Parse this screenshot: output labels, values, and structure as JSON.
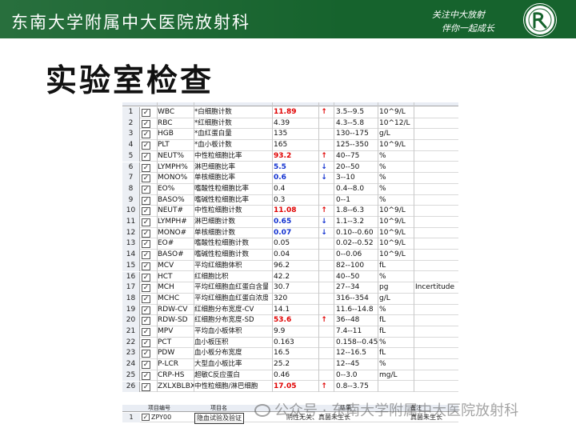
{
  "header": {
    "hospital_name": "东南大学附属中大医院放射科",
    "slogan_line1": "关注中大放射",
    "slogan_line2": "伴你一起成长",
    "bg_color": "#16632d"
  },
  "page_title": "实验室检查",
  "table": {
    "rows": [
      {
        "no": "1",
        "code": "WBC",
        "name": "*白细胞计数",
        "result": "11.89",
        "flag": "↑",
        "level": "high",
        "ref": "3.5--9.5",
        "unit": "10^9/L",
        "note": ""
      },
      {
        "no": "2",
        "code": "RBC",
        "name": "*红细胞计数",
        "result": "4.39",
        "flag": "",
        "level": "normal",
        "ref": "4.3--5.8",
        "unit": "10^12/L",
        "note": ""
      },
      {
        "no": "3",
        "code": "HGB",
        "name": "*血红蛋白量",
        "result": "135",
        "flag": "",
        "level": "normal",
        "ref": "130--175",
        "unit": "g/L",
        "note": ""
      },
      {
        "no": "4",
        "code": "PLT",
        "name": "*血小板计数",
        "result": "165",
        "flag": "",
        "level": "normal",
        "ref": "125--350",
        "unit": "10^9/L",
        "note": ""
      },
      {
        "no": "5",
        "code": "NEUT%",
        "name": "中性粒细胞比率",
        "result": "93.2",
        "flag": "↑",
        "level": "high",
        "ref": "40--75",
        "unit": "%",
        "note": ""
      },
      {
        "no": "6",
        "code": "LYMPH%",
        "name": "淋巴细胞比率",
        "result": "5.5",
        "flag": "↓",
        "level": "low",
        "ref": "20--50",
        "unit": "%",
        "note": ""
      },
      {
        "no": "7",
        "code": "MONO%",
        "name": "单核细胞比率",
        "result": "0.6",
        "flag": "↓",
        "level": "low",
        "ref": "3--10",
        "unit": "%",
        "note": ""
      },
      {
        "no": "8",
        "code": "EO%",
        "name": "嗜酸性粒细胞比率",
        "result": "0.4",
        "flag": "",
        "level": "normal",
        "ref": "0.4--8.0",
        "unit": "%",
        "note": ""
      },
      {
        "no": "9",
        "code": "BASO%",
        "name": "嗜碱性粒细胞比率",
        "result": "0.3",
        "flag": "",
        "level": "normal",
        "ref": "0--1",
        "unit": "%",
        "note": ""
      },
      {
        "no": "10",
        "code": "NEUT#",
        "name": "中性粒细胞计数",
        "result": "11.08",
        "flag": "↑",
        "level": "high",
        "ref": "1.8--6.3",
        "unit": "10^9/L",
        "note": ""
      },
      {
        "no": "11",
        "code": "LYMPH#",
        "name": "淋巴细胞计数",
        "result": "0.65",
        "flag": "↓",
        "level": "low",
        "ref": "1.1--3.2",
        "unit": "10^9/L",
        "note": ""
      },
      {
        "no": "12",
        "code": "MONO#",
        "name": "单核细胞计数",
        "result": "0.07",
        "flag": "↓",
        "level": "low",
        "ref": "0.10--0.60",
        "unit": "10^9/L",
        "note": ""
      },
      {
        "no": "13",
        "code": "EO#",
        "name": "嗜酸性粒细胞计数",
        "result": "0.05",
        "flag": "",
        "level": "normal",
        "ref": "0.02--0.52",
        "unit": "10^9/L",
        "note": ""
      },
      {
        "no": "14",
        "code": "BASO#",
        "name": "嗜碱性粒细胞计数",
        "result": "0.04",
        "flag": "",
        "level": "normal",
        "ref": "0--0.06",
        "unit": "10^9/L",
        "note": ""
      },
      {
        "no": "15",
        "code": "MCV",
        "name": "平均红细胞体积",
        "result": "96.2",
        "flag": "",
        "level": "normal",
        "ref": "82--100",
        "unit": "fL",
        "note": ""
      },
      {
        "no": "16",
        "code": "HCT",
        "name": "红细胞比积",
        "result": "42.2",
        "flag": "",
        "level": "normal",
        "ref": "40--50",
        "unit": "%",
        "note": ""
      },
      {
        "no": "17",
        "code": "MCH",
        "name": "平均红细胞血红蛋白含量",
        "result": "30.7",
        "flag": "",
        "level": "normal",
        "ref": "27--34",
        "unit": "pg",
        "note": "Incertitude"
      },
      {
        "no": "18",
        "code": "MCHC",
        "name": "平均红细胞血红蛋白浓度",
        "result": "320",
        "flag": "",
        "level": "normal",
        "ref": "316--354",
        "unit": "g/L",
        "note": ""
      },
      {
        "no": "19",
        "code": "RDW-CV",
        "name": "红细胞分布宽度-CV",
        "result": "14.1",
        "flag": "",
        "level": "normal",
        "ref": "11.6--14.8",
        "unit": "%",
        "note": ""
      },
      {
        "no": "20",
        "code": "RDW-SD",
        "name": "红细胞分布宽度-SD",
        "result": "53.6",
        "flag": "↑",
        "level": "high",
        "ref": "36--48",
        "unit": "fL",
        "note": ""
      },
      {
        "no": "21",
        "code": "MPV",
        "name": "平均血小板体积",
        "result": "9.9",
        "flag": "",
        "level": "normal",
        "ref": "7.4--11",
        "unit": "fL",
        "note": ""
      },
      {
        "no": "22",
        "code": "PCT",
        "name": "血小板压积",
        "result": "0.163",
        "flag": "",
        "level": "normal",
        "ref": "0.158--0.452",
        "unit": "%",
        "note": ""
      },
      {
        "no": "23",
        "code": "PDW",
        "name": "血小板分布宽度",
        "result": "16.5",
        "flag": "",
        "level": "normal",
        "ref": "12--16.5",
        "unit": "fL",
        "note": ""
      },
      {
        "no": "24",
        "code": "P-LCR",
        "name": "大型血小板比率",
        "result": "25.2",
        "flag": "",
        "level": "normal",
        "ref": "12--45",
        "unit": "%",
        "note": ""
      },
      {
        "no": "25",
        "code": "CRP-HS",
        "name": "超敏C反应蛋白",
        "result": "0.46",
        "flag": "",
        "level": "normal",
        "ref": "0--3.0",
        "unit": "mg/L",
        "note": ""
      },
      {
        "no": "26",
        "code": "ZXLXBLBX",
        "name": "中性粒细胞/淋巴细胞",
        "result": "17.05",
        "flag": "↑",
        "level": "high",
        "ref": "0.8--3.75",
        "unit": "",
        "note": ""
      }
    ]
  },
  "bottom_strip": {
    "header_code": "项目编号",
    "header_name": "项目名",
    "header_result": "结果",
    "header_note": "备注",
    "row_no": "1",
    "row_code": "ZPY00",
    "row_name": "隐血试验及验证",
    "row_result": "阴性无关、真菌未生长",
    "row_note": "真菌未生长"
  },
  "watermark": "公众号 · 东南大学附属中大医院放射科",
  "colors": {
    "high": "#e00000",
    "low": "#1030d0",
    "header_green": "#16632d"
  }
}
